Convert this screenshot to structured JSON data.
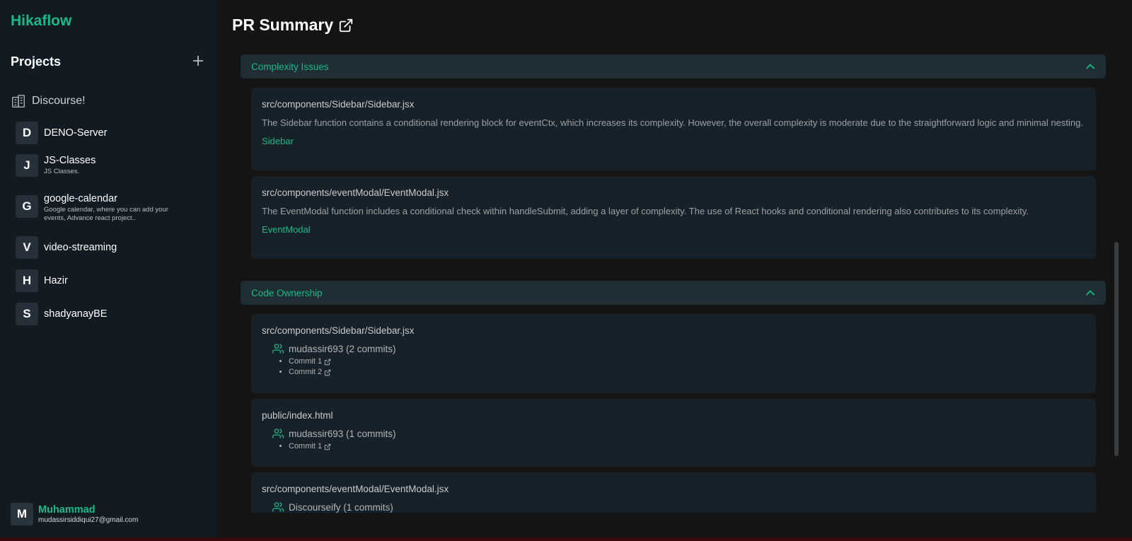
{
  "app": {
    "brand": "Hikaflow"
  },
  "sidebar": {
    "projects_title": "Projects",
    "workspace": {
      "label": "Discourse!",
      "icon": "building-icon"
    },
    "projects": [
      {
        "initial": "D",
        "name": "DENO-Server",
        "description": ""
      },
      {
        "initial": "J",
        "name": "JS-Classes",
        "description": "JS Classes."
      },
      {
        "initial": "G",
        "name": "google-calendar",
        "description": "Google calendar, where you can add your events, Advance react project.."
      },
      {
        "initial": "V",
        "name": "video-streaming",
        "description": ""
      },
      {
        "initial": "H",
        "name": "Hazir",
        "description": ""
      },
      {
        "initial": "S",
        "name": "shadyanayBE",
        "description": ""
      }
    ],
    "user": {
      "initial": "M",
      "name": "Muhammad",
      "email": "mudassirsiddiqui27@gmail.com"
    }
  },
  "main": {
    "title": "PR Summary",
    "sections": [
      {
        "title": "Complexity Issues",
        "cards": [
          {
            "path": "src/components/Sidebar/Sidebar.jsx",
            "description": "The Sidebar function contains a conditional rendering block for eventCtx, which increases its complexity. However, the overall complexity is moderate due to the straightforward logic and minimal nesting.",
            "link": "Sidebar"
          },
          {
            "path": "src/components/eventModal/EventModal.jsx",
            "description": "The EventModal function includes a conditional check within handleSubmit, adding a layer of complexity. The use of React hooks and conditional rendering also contributes to its complexity.",
            "link": "EventModal"
          }
        ]
      },
      {
        "title": "Code Ownership",
        "cards": [
          {
            "path": "src/components/Sidebar/Sidebar.jsx",
            "owner": "mudassir693 (2 commits)",
            "commits": [
              "Commit 1",
              "Commit 2"
            ]
          },
          {
            "path": "public/index.html",
            "owner": "mudassir693 (1 commits)",
            "commits": [
              "Commit 1"
            ]
          },
          {
            "path": "src/components/eventModal/EventModal.jsx",
            "owner": "Discourseify (1 commits)",
            "commits": []
          }
        ]
      }
    ]
  },
  "colors": {
    "accent": "#19b98a",
    "sidebar_bg": "#121b22",
    "main_bg": "#141414",
    "section_bg": "#1f2d35",
    "card_bg": "#17212a"
  }
}
